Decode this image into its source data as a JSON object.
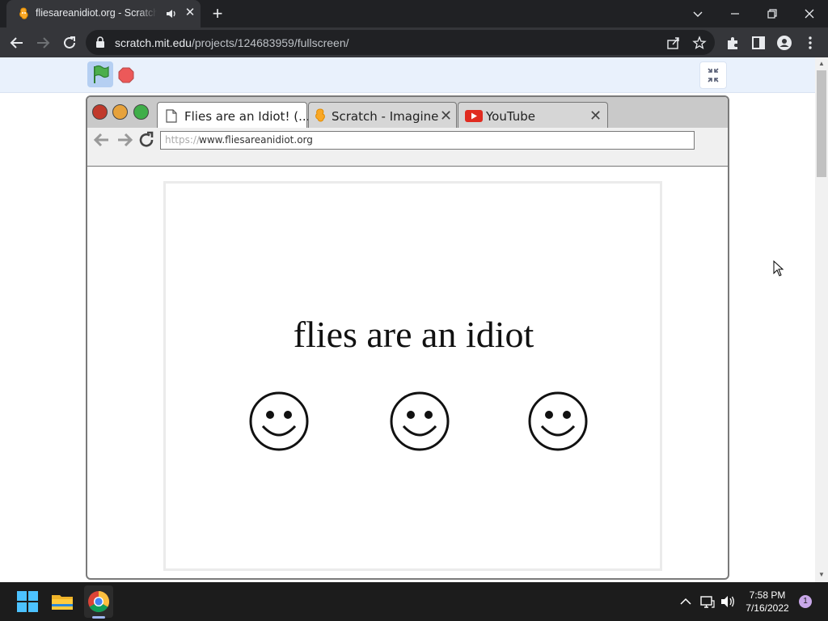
{
  "tab": {
    "title": "fliesareanidiot.org - Scratch",
    "close": "✕"
  },
  "newtab": "+",
  "omnibox": {
    "host": "scratch.mit.edu",
    "path": "/projects/124683959/fullscreen/"
  },
  "stage": {
    "tabs": [
      {
        "label": "Flies are an Idiot! (...",
        "icon": "document-icon"
      },
      {
        "label": "Scratch - Imagine",
        "icon": "scratch-icon"
      },
      {
        "label": "YouTube",
        "icon": "youtube-icon"
      }
    ],
    "tab_close": "✕",
    "address_proto": "https://",
    "address_domain": "www.fliesareanidiot.org",
    "headline": "flies are an idiot",
    "smiley_count": 3
  },
  "taskbar": {
    "time": "7:58 PM",
    "date": "7/16/2022",
    "notifications": "1"
  },
  "colors": {
    "chrome_dark": "#202124",
    "chrome_tab": "#35363a",
    "scratch_bar": "#e9f1fc",
    "flag_green": "#4cae4c",
    "stop_red": "#ec5959"
  }
}
